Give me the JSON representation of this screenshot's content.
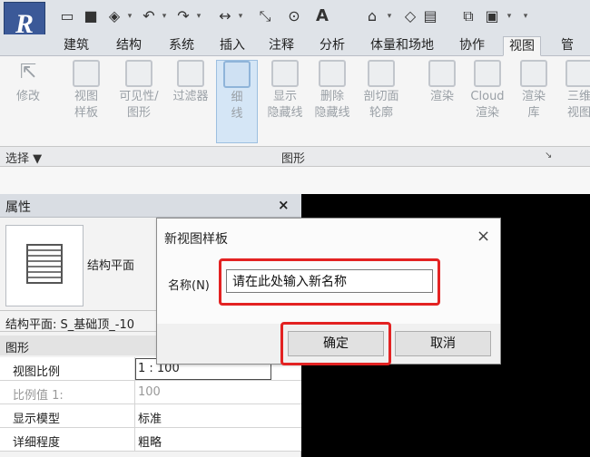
{
  "app": {
    "logo_letter": "R"
  },
  "qat": {
    "text_tool": "A"
  },
  "tabs": [
    "建筑",
    "结构",
    "系统",
    "插入",
    "注释",
    "分析",
    "体量和场地",
    "协作",
    "视图",
    "管理"
  ],
  "active_tab": "视图",
  "ribbon": {
    "modify": "修改",
    "view_template": [
      "视图",
      "样板"
    ],
    "visibility": [
      "可见性/",
      "图形"
    ],
    "filters": "过滤器",
    "thin_lines": [
      "细",
      "线"
    ],
    "show_hidden": [
      "显示",
      "隐藏线"
    ],
    "remove_hidden": [
      "删除",
      "隐藏线"
    ],
    "cut_profile": [
      "剖切面",
      "轮廓"
    ],
    "render": "渲染",
    "cloud_render": [
      "Cloud",
      "渲染"
    ],
    "render_gallery": [
      "渲染",
      "库"
    ],
    "threed": [
      "三维",
      "视图"
    ]
  },
  "panel_footer": {
    "select": "选择 ▼",
    "graphics": "图形",
    "launcher": "↘"
  },
  "properties": {
    "title": "属性",
    "close": "×",
    "type_name": "结构平面",
    "instance": "结构平面: S_基础顶_-10",
    "category": "图形",
    "rows": [
      {
        "name": "视图比例",
        "value": "1 : 100",
        "dim": false,
        "selected": true
      },
      {
        "name": "比例值 1:",
        "value": "100",
        "dim": true,
        "selected": false
      },
      {
        "name": "显示模型",
        "value": "标准",
        "dim": false,
        "selected": false
      },
      {
        "name": "详细程度",
        "value": "粗略",
        "dim": false,
        "selected": false
      }
    ]
  },
  "dialog": {
    "title": "新视图样板",
    "close": "×",
    "name_label": "名称(N)",
    "name_value": "请在此处输入新名称",
    "ok": "确定",
    "cancel": "取消"
  }
}
